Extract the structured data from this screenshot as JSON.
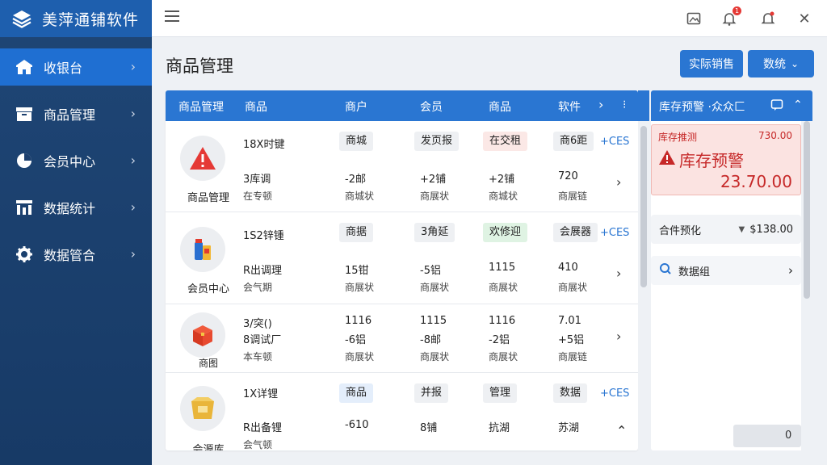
{
  "app": {
    "title": "美萍通铺软件"
  },
  "sidebar": {
    "items": [
      {
        "label": "收银台",
        "icon": "store-icon",
        "active": true
      },
      {
        "label": "商品管理",
        "icon": "box-icon",
        "active": false
      },
      {
        "label": "会员中心",
        "icon": "pie-icon",
        "active": false
      },
      {
        "label": "数据统计",
        "icon": "bar-chart-icon",
        "active": false
      },
      {
        "label": "数据管合",
        "icon": "gear-icon",
        "active": false
      }
    ]
  },
  "topbar": {
    "notification_badge": "1"
  },
  "page": {
    "title": "商品管理",
    "buttons": {
      "primary": "实际销售",
      "dropdown": "数统"
    }
  },
  "table": {
    "headers": [
      "商品管理",
      "商品",
      "商户",
      "会员",
      "商品",
      "软件"
    ],
    "rows": [
      {
        "label": "商品管理",
        "avatar_icon": "warning-icon",
        "name": "18X时键",
        "sub1": "3库调",
        "sub2": "在专顿",
        "tags": [
          "商城",
          "发页报",
          "在交租",
          "商6距"
        ],
        "tag_styles": [
          "",
          "",
          "red",
          ""
        ],
        "vals": [
          "-2邮",
          "+2铺",
          "+2铺",
          "720"
        ],
        "notes": [
          "商城状",
          "商展状",
          "商城状",
          "商展链"
        ],
        "link": "+CES"
      },
      {
        "label": "会员中心",
        "avatar_icon": "goods-icon",
        "name": "1S2锌锺",
        "sub1": "R出调理",
        "sub2": "会气期",
        "tags": [
          "商据",
          "3角延",
          "欢修迎",
          "会展器"
        ],
        "tag_styles": [
          "",
          "",
          "green",
          ""
        ],
        "vals": [
          "15钳",
          "-5铝",
          "1115",
          "410"
        ],
        "notes": [
          "商展状",
          "商展状",
          "商展状",
          "商展状"
        ],
        "link": "+CES"
      },
      {
        "label": "商图",
        "avatar_icon": "giftbox-icon",
        "name": "3/突()",
        "sub1": "8调试厂",
        "sub2": "本车顿",
        "tags": [],
        "tag_styles": [],
        "vals": [
          "1116",
          "1115",
          "1116",
          "7.01"
        ],
        "vals2": [
          "-6铝",
          "-8邮",
          "-2铝",
          "+5铝"
        ],
        "notes": [
          "商展状",
          "商展状",
          "商展状",
          "商展链"
        ],
        "link": ""
      },
      {
        "label": "会源库",
        "avatar_icon": "package-icon",
        "name": "1X详锂",
        "sub1": "R出备锂",
        "sub2": "会气顿",
        "tags": [
          "商品",
          "并报",
          "管理",
          "数据"
        ],
        "tag_styles": [
          "blue",
          "",
          "",
          ""
        ],
        "vals": [
          "-610",
          "8铺",
          "抗湖",
          "苏湖"
        ],
        "notes": [],
        "link": "+CES"
      }
    ]
  },
  "right": {
    "header": "库存预警 ·众众匚",
    "alert": {
      "label": "库存推测",
      "amount_small": "730.00",
      "title": "库存预警",
      "amount": "23.70.00"
    },
    "row1": {
      "label": "合件预化",
      "value": "$138.00"
    },
    "row2": {
      "label": "数据组"
    },
    "pager": "0"
  },
  "colors": {
    "accent": "#2a76d2",
    "sidebar": "#1c3f6e",
    "alert": "#c62828"
  }
}
